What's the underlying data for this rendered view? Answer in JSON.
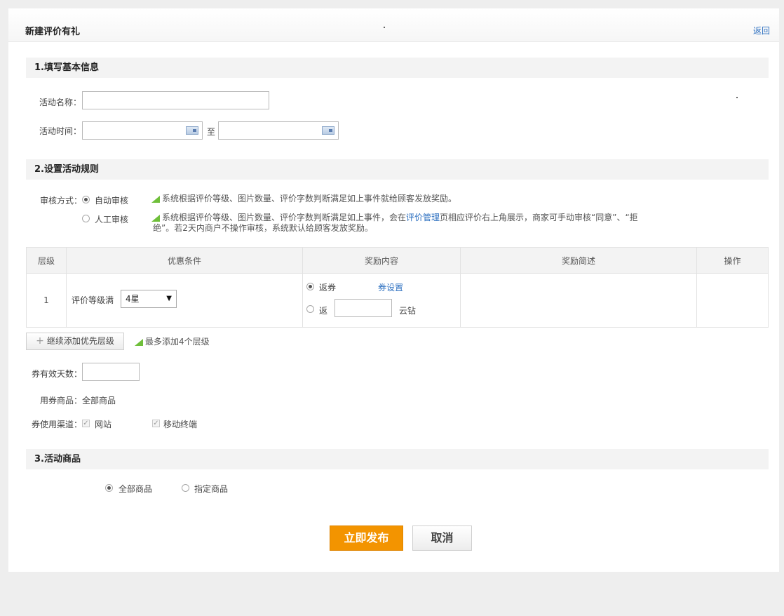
{
  "header": {
    "title": "新建评价有礼",
    "back_label": "返回"
  },
  "section1": {
    "title": "1.填写基本信息",
    "name_label": "活动名称：",
    "name_value": "",
    "time_label": "活动时间：",
    "time_start": "",
    "time_to": "至",
    "time_end": ""
  },
  "section2": {
    "title": "2.设置活动规则",
    "review_label": "审核方式：",
    "auto_label": "自动审核",
    "auto_hint": "系统根据评价等级、图片数量、评价字数判断满足如上事件就给顾客发放奖励。",
    "manual_label": "人工审核",
    "manual_hint_a": "系统根据评价等级、图片数量、评价字数判断满足如上事件，会在",
    "manual_hint_link": "评价管理",
    "manual_hint_b": "页相应评价右上角展示，商家可手动审核“同意”、“拒",
    "manual_hint_c": "绝”。若2天内商户不操作审核，系统默认给顾客发放奖励。",
    "table": {
      "headers": [
        "层级",
        "优惠条件",
        "奖励内容",
        "奖励简述",
        "操作"
      ],
      "row": {
        "level": "1",
        "condition_label": "评价等级满",
        "condition_value": "4星",
        "coupon_label": "返券",
        "coupon_link": "券设置",
        "points_label": "返",
        "points_value": "",
        "points_unit": "云钻",
        "summary": "",
        "ops": ""
      }
    },
    "add_button": "继续添加优先层级",
    "add_hint": "最多添加4个层级",
    "valid_days_label": "券有效天数：",
    "valid_days_value": "",
    "goods_label": "用券商品：",
    "goods_value": "全部商品",
    "channel_label": "券使用渠道：",
    "channel_web": "网站",
    "channel_mobile": "移动终端"
  },
  "section3": {
    "title": "3.活动商品",
    "all_goods": "全部商品",
    "specified_goods": "指定商品"
  },
  "footer": {
    "publish": "立即发布",
    "cancel": "取消"
  },
  "colors": {
    "accent": "#f39400",
    "link": "#2c6fc0",
    "hint_triangle": "#6fbf3a"
  }
}
